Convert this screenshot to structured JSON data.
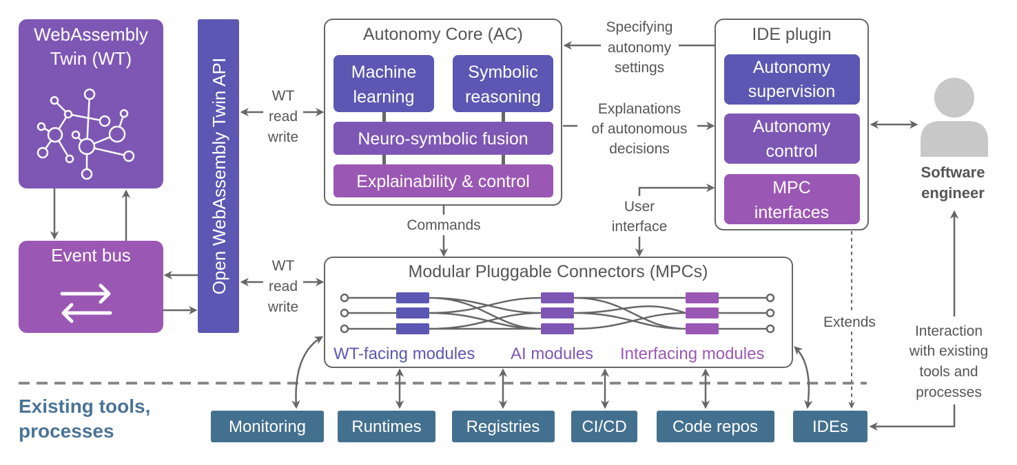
{
  "colors": {
    "indigo": "#5b57b2",
    "purple": "#7e57b4",
    "magenta": "#9b57b4",
    "tools": "#44708f",
    "tools_label": "#4a7396",
    "line": "#666666"
  },
  "wt": {
    "line1": "WebAssembly",
    "line2": "Twin (WT)",
    "icon": "network-graph-icon"
  },
  "event_bus": {
    "label": "Event bus",
    "icon": "swap-arrows-icon"
  },
  "api": {
    "label": "Open WebAssembly Twin API"
  },
  "wt_rw_top": [
    "WT",
    "read",
    "write"
  ],
  "wt_rw_bottom": [
    "WT",
    "read",
    "write"
  ],
  "ac": {
    "title": "Autonomy Core (AC)",
    "ml": [
      "Machine",
      "learning"
    ],
    "sr": [
      "Symbolic",
      "reasoning"
    ],
    "fusion": "Neuro-symbolic fusion",
    "explain": "Explainability & control"
  },
  "labels": {
    "specifying": [
      "Specifying",
      "autonomy",
      "settings"
    ],
    "explanations": [
      "Explanations",
      "of autonomous",
      "decisions"
    ],
    "user_interface": [
      "User",
      "interface"
    ],
    "commands": "Commands",
    "extends": "Extends",
    "interaction": [
      "Interaction",
      "with existing",
      "tools and",
      "processes"
    ]
  },
  "ide": {
    "title": "IDE plugin",
    "supervision": [
      "Autonomy",
      "supervision"
    ],
    "control": [
      "Autonomy",
      "control"
    ],
    "mpc": [
      "MPC",
      "interfaces"
    ]
  },
  "engineer": {
    "line1": "Software",
    "line2": "engineer",
    "icon": "user-icon"
  },
  "mpc": {
    "title": "Modular Pluggable Connectors (MPCs)",
    "wt_modules": "WT-facing modules",
    "ai_modules": "AI modules",
    "int_modules": "Interfacing modules"
  },
  "existing": {
    "line1": "Existing tools,",
    "line2": "processes"
  },
  "tools": [
    "Monitoring",
    "Runtimes",
    "Registries",
    "CI/CD",
    "Code repos",
    "IDEs"
  ]
}
